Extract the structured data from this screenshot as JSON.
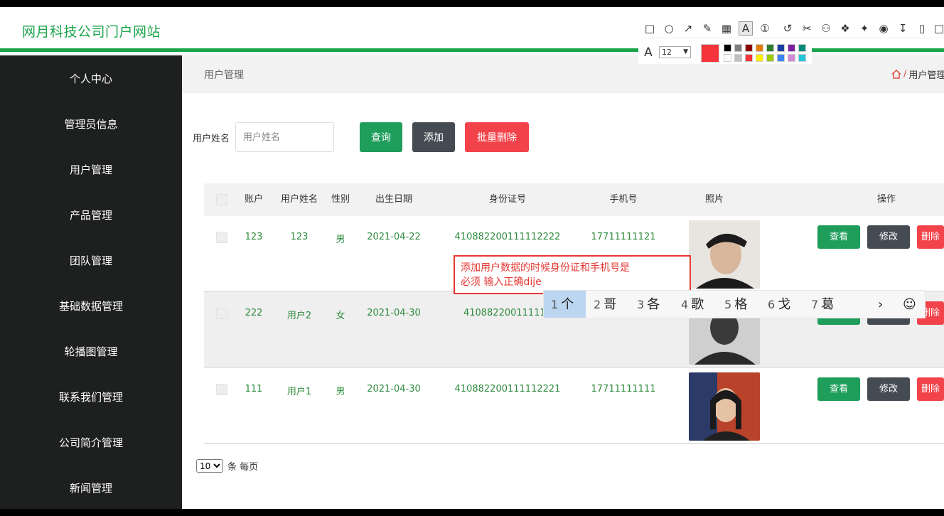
{
  "header": {
    "brand": "网月科技公司门户网站"
  },
  "sidebar": {
    "items": [
      "个人中心",
      "管理员信息",
      "用户管理",
      "产品管理",
      "团队管理",
      "基础数据管理",
      "轮播图管理",
      "联系我们管理",
      "公司简介管理",
      "新闻管理"
    ]
  },
  "breadcrumb": {
    "title": "用户管理",
    "trail": "用户管理"
  },
  "search": {
    "label": "用户姓名",
    "placeholder": "用户姓名",
    "query_label": "查询",
    "add_label": "添加",
    "batch_delete_label": "批量删除"
  },
  "table": {
    "headers": [
      "账户",
      "用户姓名",
      "性别",
      "出生日期",
      "身份证号",
      "手机号",
      "照片",
      "操作"
    ],
    "rows": [
      {
        "account": "123",
        "name": "123",
        "gender": "男",
        "birth": "2021-04-22",
        "id_card": "410882200111112222",
        "phone": "17711111121"
      },
      {
        "account": "222",
        "name": "用户2",
        "gender": "女",
        "birth": "2021-04-30",
        "id_card": "410882200111111",
        "phone": ""
      },
      {
        "account": "111",
        "name": "用户1",
        "gender": "男",
        "birth": "2021-04-30",
        "id_card": "410882200111112221",
        "phone": "17711111111"
      }
    ],
    "actions": {
      "view": "查看",
      "edit": "修改",
      "delete": "删除"
    }
  },
  "pager": {
    "page_size": "10",
    "unit": "条 每页"
  },
  "annotation": {
    "font_size": "12",
    "text_line1": "添加用户数据的时候身份证和手机号是",
    "text_line2": "必须 输入正确dije"
  },
  "ime": {
    "candidates": [
      {
        "num": "1",
        "char": "个"
      },
      {
        "num": "2",
        "char": "哥"
      },
      {
        "num": "3",
        "char": "各"
      },
      {
        "num": "4",
        "char": "歌"
      },
      {
        "num": "5",
        "char": "格"
      },
      {
        "num": "6",
        "char": "戈"
      },
      {
        "num": "7",
        "char": "葛"
      }
    ]
  },
  "colors": {
    "accent": "#1aa34a",
    "sidebar": "#1e1f1f",
    "danger": "#f2424a",
    "dark_button": "#454b53",
    "annotation": "#e53935"
  }
}
